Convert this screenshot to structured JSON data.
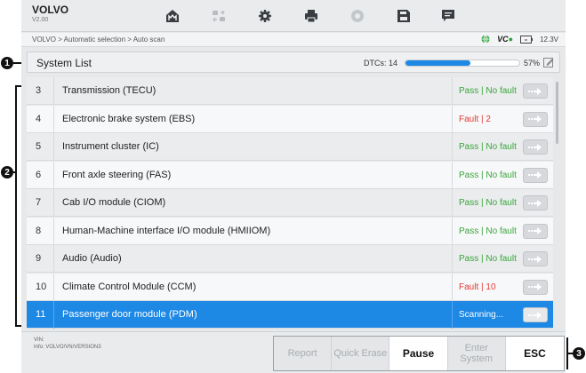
{
  "app": {
    "brand": "VOLVO",
    "version": "V2.00"
  },
  "callouts": [
    "1",
    "2",
    "3"
  ],
  "toolbar": {
    "buttons": [
      {
        "icon": "home-icon"
      },
      {
        "icon": "vehicle-swap-icon"
      },
      {
        "icon": "gear-icon"
      },
      {
        "icon": "printer-icon"
      },
      {
        "icon": "help-icon"
      },
      {
        "icon": "save-icon"
      },
      {
        "icon": "data-log-icon"
      }
    ]
  },
  "breadcrumb": "VOLVO > Automatic selection > Auto scan",
  "status": {
    "vci_text": "VC",
    "voltage": "12.3V"
  },
  "system_header": {
    "title": "System List",
    "dtc_label": "DTCs: 14",
    "progress_percent": 57,
    "progress_text": "57%"
  },
  "systems": [
    {
      "num": "3",
      "name": "Transmission (TECU)",
      "status": "Pass | No fault",
      "state": "pass"
    },
    {
      "num": "4",
      "name": "Electronic brake system (EBS)",
      "status": "Fault | 2",
      "state": "fault"
    },
    {
      "num": "5",
      "name": "Instrument cluster (IC)",
      "status": "Pass | No fault",
      "state": "pass"
    },
    {
      "num": "6",
      "name": "Front axle steering (FAS)",
      "status": "Pass | No fault",
      "state": "pass"
    },
    {
      "num": "7",
      "name": "Cab I/O module (CIOM)",
      "status": "Pass | No fault",
      "state": "pass"
    },
    {
      "num": "8",
      "name": "Human-Machine interface I/O module (HMIIOM)",
      "status": "Pass | No fault",
      "state": "pass"
    },
    {
      "num": "9",
      "name": "Audio (Audio)",
      "status": "Pass | No fault",
      "state": "pass"
    },
    {
      "num": "10",
      "name": "Climate Control Module (CCM)",
      "status": "Fault | 10",
      "state": "fault"
    },
    {
      "num": "11",
      "name": "Passenger door module (PDM)",
      "status": "Scanning...",
      "state": "scan"
    }
  ],
  "footer": {
    "vin_label": "VIN:",
    "info_label": "Info: VOLVO/VN/VERSION3",
    "buttons": [
      {
        "label": "Report",
        "enabled": false
      },
      {
        "label": "Quick Erase",
        "enabled": false
      },
      {
        "label": "Pause",
        "enabled": true
      },
      {
        "label": "Enter System",
        "enabled": false
      },
      {
        "label": "ESC",
        "enabled": true
      }
    ]
  },
  "colors": {
    "accent": "#1e88e5",
    "pass": "#3aa53a",
    "fault": "#e53935"
  }
}
